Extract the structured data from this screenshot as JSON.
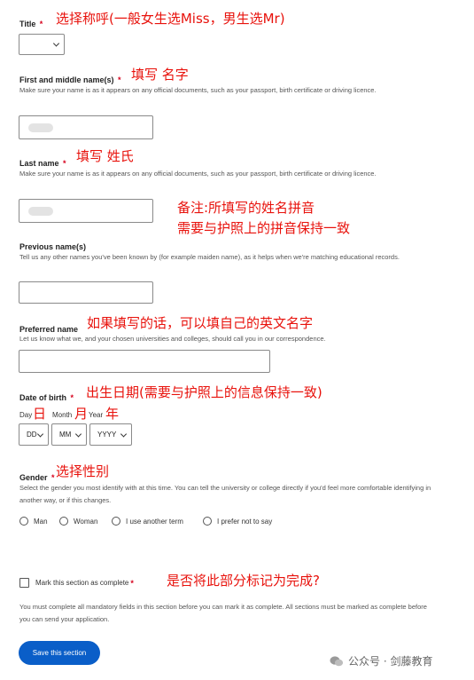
{
  "title": {
    "label": "Title",
    "req": "*",
    "note": "选择称呼(一般女生选Miss，男生选Mr)"
  },
  "first_name": {
    "label": "First and middle name(s)",
    "req": "*",
    "note": "填写 名字",
    "hint": "Make sure your name is as it appears on any official documents, such as your passport, birth certificate or driving licence."
  },
  "last_name": {
    "label": "Last name",
    "req": "*",
    "note": "填写 姓氏",
    "hint": "Make sure your name is as it appears on any official documents, such as your passport, birth certificate or driving licence."
  },
  "name_note": {
    "line1": "备注:所填写的姓名拼音",
    "line2": "需要与护照上的拼音保持一致"
  },
  "previous_name": {
    "label": "Previous name(s)",
    "hint": "Tell us any other names you've been known by (for example maiden name), as it helps when we're matching educational records."
  },
  "preferred_name": {
    "label": "Preferred name",
    "note": "如果填写的话，可以填自己的英文名字",
    "hint": "Let us know what we, and your chosen universities and colleges, should call you in our correspondence."
  },
  "dob": {
    "label": "Date of birth",
    "req": "*",
    "note": "出生日期(需要与护照上的信息保持一致)",
    "day_label": "Day",
    "month_label": "Month",
    "year_label": "Year",
    "day_note": "日",
    "month_note": "月",
    "year_note": "年",
    "day_value": "DD",
    "month_value": "MM",
    "year_value": "YYYY"
  },
  "gender": {
    "label": "Gender",
    "req": "*",
    "note": "选择性别",
    "hint": "Select the gender you most identify with at this time. You can tell the university or college directly if you'd feel more comfortable identifying in another way, or if this changes.",
    "options": [
      "Man",
      "Woman",
      "I use another term",
      "I prefer not to say"
    ]
  },
  "complete": {
    "label": "Mark this section as complete",
    "req": "*",
    "note": "是否将此部分标记为完成?",
    "hint": "You must complete all mandatory fields in this section before you can mark it as complete. All sections must be marked as complete before you can send your application."
  },
  "save_button": "Save this section",
  "watermark": "公众号 · 剑藤教育"
}
